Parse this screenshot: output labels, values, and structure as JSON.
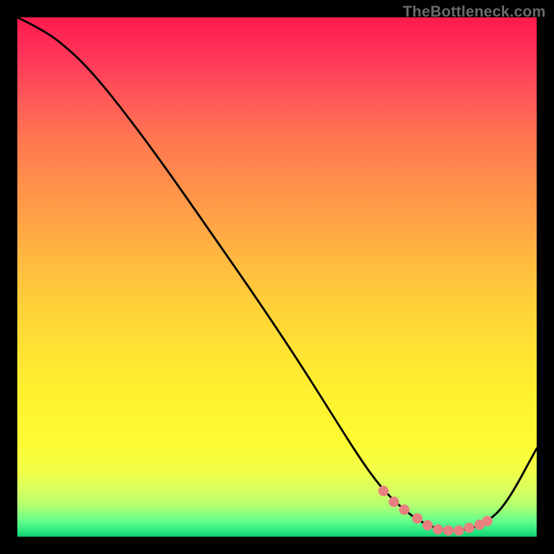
{
  "watermark": "TheBottleneck.com",
  "chart_data": {
    "type": "line",
    "title": "",
    "xlabel": "",
    "ylabel": "",
    "xlim": [
      0,
      100
    ],
    "ylim": [
      0,
      100
    ],
    "grid": false,
    "series": [
      {
        "name": "curve",
        "x": [
          0,
          4,
          8,
          14,
          22,
          30,
          38,
          46,
          54,
          60,
          66,
          70,
          74,
          78,
          82,
          86,
          90,
          94,
          100
        ],
        "y": [
          100,
          98,
          95.5,
          90,
          80,
          69,
          57.5,
          46,
          34,
          24.5,
          15,
          9.5,
          5.5,
          2.6,
          1.2,
          1.2,
          2.5,
          6,
          17
        ]
      },
      {
        "name": "dots",
        "x": [
          70.5,
          72.5,
          74.5,
          77,
          79,
          81,
          83,
          85,
          87,
          89,
          90.5
        ],
        "y": [
          8.8,
          6.7,
          5.2,
          3.5,
          2.2,
          1.4,
          1.2,
          1.2,
          1.7,
          2.3,
          3.0
        ]
      }
    ],
    "colors": {
      "curve": "#000000",
      "dots": "#e88080",
      "gradient_top": "#ff1a4d",
      "gradient_bottom": "#14c96f"
    }
  }
}
